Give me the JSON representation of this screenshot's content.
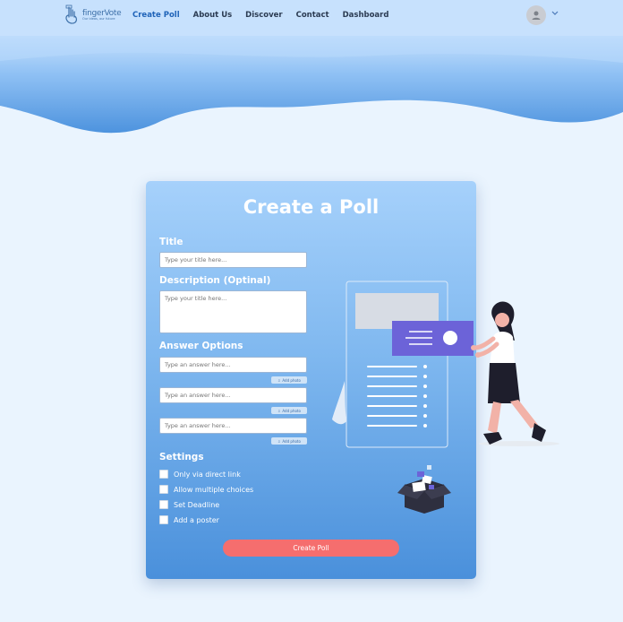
{
  "brand": {
    "name": "fingerVote",
    "tagline": "Our ideas, our future"
  },
  "nav": {
    "items": [
      {
        "label": "Create Poll",
        "active": true
      },
      {
        "label": "About Us"
      },
      {
        "label": "Discover"
      },
      {
        "label": "Contact"
      },
      {
        "label": "Dashboard"
      }
    ]
  },
  "form": {
    "heading": "Create a Poll",
    "title_label": "Title",
    "title_placeholder": "Type your title here...",
    "description_label": "Description (Optinal)",
    "description_placeholder": "Type your title here...",
    "answers_label": "Answer Options",
    "answers": [
      {
        "placeholder": "Type an answer here...",
        "add_photo": "Add photo"
      },
      {
        "placeholder": "Type an answer here...",
        "add_photo": "Add photo"
      },
      {
        "placeholder": "Type an answer here...",
        "add_photo": "Add photo"
      }
    ],
    "settings_label": "Settings",
    "settings": [
      {
        "label": "Only via direct link",
        "checked": false
      },
      {
        "label": "Allow multiple choices",
        "checked": false
      },
      {
        "label": "Set Deadline",
        "checked": false
      },
      {
        "label": "Add a poster",
        "checked": false
      }
    ],
    "submit_label": "Create Poll"
  },
  "colors": {
    "accent": "#1f63b8",
    "submit": "#f56e6e",
    "card_top": "#a6d1fb",
    "card_bottom": "#4a90db",
    "page_bg": "#eaf4fe"
  }
}
